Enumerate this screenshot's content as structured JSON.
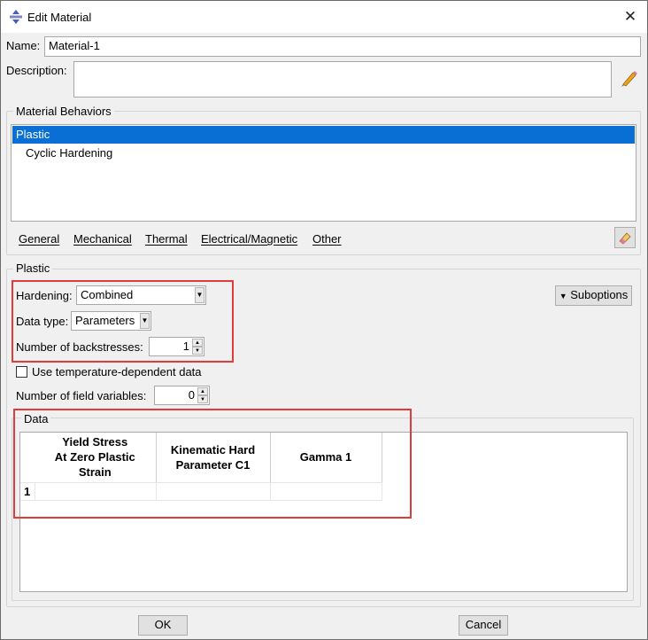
{
  "window": {
    "title": "Edit Material",
    "close_glyph": "✕"
  },
  "name": {
    "label": "Name:",
    "value": "Material-1"
  },
  "description": {
    "label": "Description:",
    "value": ""
  },
  "behaviors": {
    "group_title": "Material Behaviors",
    "items": [
      "Plastic",
      "Cyclic Hardening"
    ],
    "menu": [
      "General",
      "Mechanical",
      "Thermal",
      "Electrical/Magnetic",
      "Other"
    ]
  },
  "plastic": {
    "group_title": "Plastic",
    "hardening": {
      "label": "Hardening:",
      "value": "Combined"
    },
    "data_type": {
      "label": "Data type:",
      "value": "Parameters"
    },
    "backstresses": {
      "label": "Number of backstresses:",
      "value": "1"
    },
    "temp_dependent": {
      "label": "Use temperature-dependent data",
      "checked": false
    },
    "field_vars": {
      "label": "Number of field variables:",
      "value": "0"
    },
    "suboptions_label": "Suboptions"
  },
  "data": {
    "group_title": "Data",
    "columns": [
      "Yield Stress\nAt Zero Plastic\nStrain",
      "Kinematic Hard\nParameter C1",
      "Gamma 1"
    ],
    "rows": [
      {
        "num": "1",
        "cells": [
          "",
          "",
          ""
        ]
      }
    ]
  },
  "footer": {
    "ok_label": "OK",
    "cancel_label": "Cancel"
  },
  "colors": {
    "selection": "#0a6fd4",
    "highlight_box": "#e03c3c"
  }
}
